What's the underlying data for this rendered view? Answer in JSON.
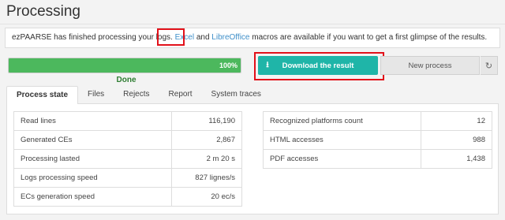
{
  "page": {
    "title": "Processing"
  },
  "message": {
    "text_before": "ezPAARSE has finished processing your logs.",
    "excel_link": "Excel",
    "text_and": "and",
    "libreoffice_link": "LibreOffice",
    "text_after": "macros are available if you want to get a first glimpse of the results."
  },
  "progress": {
    "value_percent": 100,
    "label": "100%",
    "status": "Done"
  },
  "actions": {
    "download_label": "Download the result",
    "download_icon": "download-icon",
    "new_process_label": "New process",
    "refresh_icon": "refresh-icon"
  },
  "tabs": [
    {
      "label": "Process state",
      "active": true
    },
    {
      "label": "Files",
      "active": false
    },
    {
      "label": "Rejects",
      "active": false
    },
    {
      "label": "Report",
      "active": false
    },
    {
      "label": "System traces",
      "active": false
    }
  ],
  "stats_left": [
    {
      "label": "Read lines",
      "value": "116,190"
    },
    {
      "label": "Generated CEs",
      "value": "2,867"
    },
    {
      "label": "Processing lasted",
      "value": "2 m 20 s"
    },
    {
      "label": "Logs processing speed",
      "value": "827 lignes/s"
    },
    {
      "label": "ECs generation speed",
      "value": "20 ec/s"
    }
  ],
  "stats_right": [
    {
      "label": "Recognized platforms count",
      "value": "12"
    },
    {
      "label": "HTML accesses",
      "value": "988"
    },
    {
      "label": "PDF accesses",
      "value": "1,438"
    }
  ],
  "colors": {
    "progress_fill": "#4cb85d",
    "download_button": "#1fb5a8",
    "link": "#3f8fc9",
    "highlight": "#e2111a",
    "done_text": "#2e7d32"
  }
}
